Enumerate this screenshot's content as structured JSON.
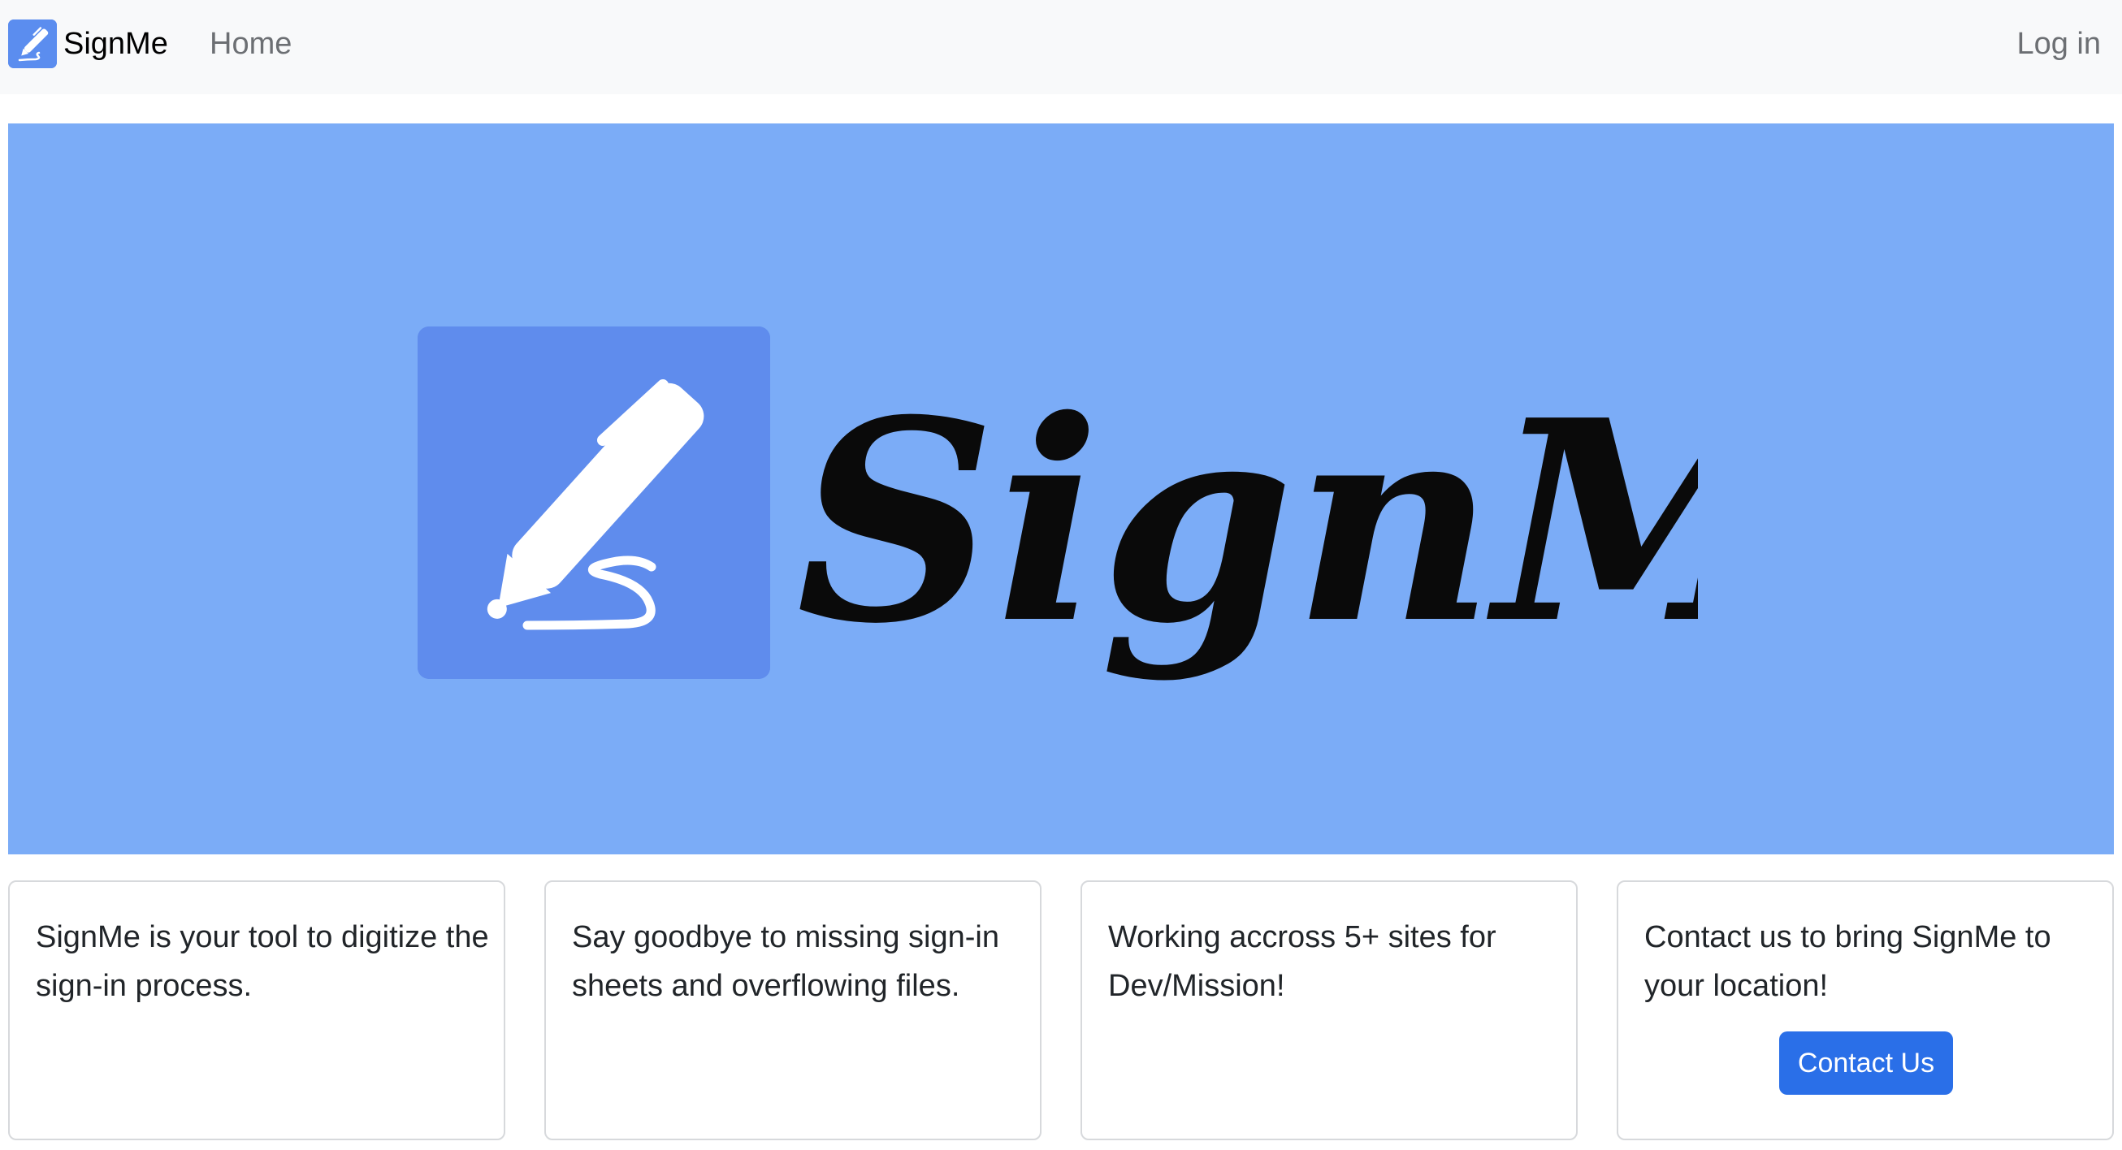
{
  "navbar": {
    "brand_label": "SignMe",
    "home_label": "Home",
    "login_label": "Log in"
  },
  "hero": {
    "wordmark": "SignMe"
  },
  "cards": [
    {
      "text": "SignMe is your tool to digitize the sign-in process."
    },
    {
      "text": "Say goodbye to missing sign-in sheets and overflowing files."
    },
    {
      "text": "Working accross 5+ sites for Dev/Mission!"
    },
    {
      "text": "Contact us to bring SignMe to your location!",
      "button_label": "Contact Us"
    }
  ],
  "colors": {
    "navbar_bg": "#f8f9fa",
    "hero_bg": "#7bacf7",
    "logo_tile": "#5f8ced",
    "button": "#2a6fe8"
  },
  "icons": {
    "brand_icon": "pen-signature-icon",
    "hero_icon": "pen-signature-icon"
  }
}
